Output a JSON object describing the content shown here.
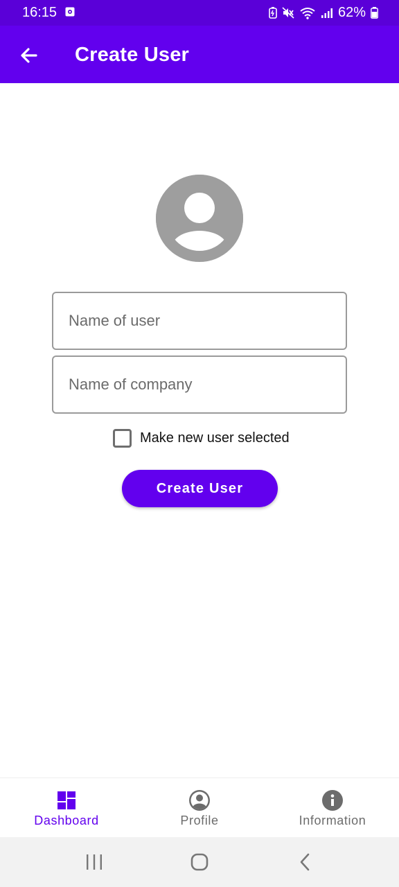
{
  "status_bar": {
    "time": "16:15",
    "battery": "62%"
  },
  "app_bar": {
    "title": "Create User",
    "back_icon": "arrow-back-icon"
  },
  "form": {
    "avatar_icon": "account-circle-icon",
    "user_name": {
      "value": "",
      "placeholder": "Name of user"
    },
    "company_name": {
      "value": "",
      "placeholder": "Name of company"
    },
    "select_checkbox": {
      "label": "Make new user selected",
      "checked": false
    },
    "create_button_label": "Create User"
  },
  "bottom_nav": {
    "items": [
      {
        "label": "Dashboard",
        "icon": "dashboard-icon",
        "active": true
      },
      {
        "label": "Profile",
        "icon": "account-circle-icon",
        "active": false
      },
      {
        "label": "Information",
        "icon": "info-icon",
        "active": false
      }
    ]
  },
  "system_nav": {
    "recents_icon": "recents-icon",
    "home_icon": "home-icon",
    "back_icon": "back-chevron-icon"
  },
  "colors": {
    "primary": "#6200ee",
    "status_bar": "#5a00d8",
    "avatar_gray": "#9e9e9e",
    "inactive_nav": "#6c6c6c"
  }
}
